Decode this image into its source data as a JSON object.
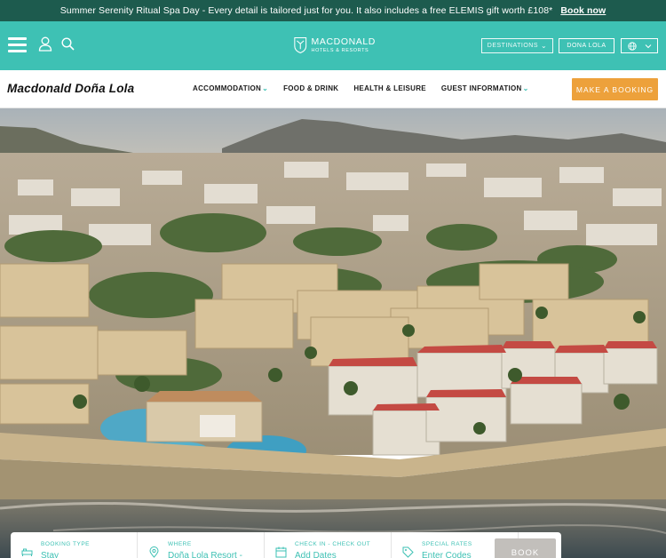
{
  "promo": {
    "text": "Summer Serenity Ritual Spa Day - Every detail is tailored just for you. It also includes a free ELEMIS gift worth £108*",
    "link": "Book now"
  },
  "brand": {
    "logo_line1": "MACDONALD",
    "logo_line2": "HOTELS & RESORTS",
    "destinations_label": "DESTINATIONS",
    "hotel_label": "DONA LOLA",
    "icons": [
      "menu-icon",
      "user-icon",
      "search-icon",
      "globe-icon",
      "chevron-down-icon"
    ]
  },
  "hotel": {
    "name": "Macdonald Doña Lola",
    "nav": [
      {
        "label": "ACCOMMODATION",
        "has_dropdown": true
      },
      {
        "label": "FOOD & DRINK",
        "has_dropdown": false
      },
      {
        "label": "HEALTH & LEISURE",
        "has_dropdown": false
      },
      {
        "label": "GUEST INFORMATION",
        "has_dropdown": true
      }
    ],
    "cta": "MAKE A BOOKING"
  },
  "booking": {
    "fields": [
      {
        "label": "BOOKING TYPE",
        "value": "Stay",
        "icon": "bed-icon"
      },
      {
        "label": "WHERE",
        "value": "Doña Lola Resort -",
        "icon": "location-pin-icon"
      },
      {
        "label": "CHECK IN - CHECK OUT",
        "value": "Add Dates",
        "icon": "calendar-icon"
      },
      {
        "label": "SPECIAL RATES",
        "value": "Enter Codes",
        "icon": "tag-icon"
      }
    ],
    "book_label": "BOOK"
  },
  "colors": {
    "promo_bg": "#1d5b4e",
    "brand_teal": "#3ec1b4",
    "booking_orange": "#eda13b",
    "book_button_disabled": "#c2bfbb"
  }
}
